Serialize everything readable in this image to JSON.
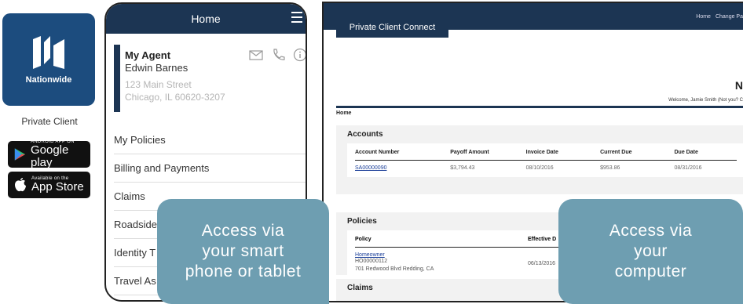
{
  "brand": {
    "name": "Nationwide",
    "caption": "Private Client",
    "color": "#1c4c7e"
  },
  "badges": {
    "google": {
      "small": "ANDROID APP ON",
      "big": "Google play",
      "icon": "play-triangle-icon"
    },
    "apple": {
      "small": "Available on the",
      "big": "App Store",
      "icon": "apple-icon"
    }
  },
  "phone": {
    "title": "Home",
    "agent": {
      "label": "My Agent",
      "name": "Edwin Barnes",
      "address1": "123 Main Street",
      "address2": "Chicago, IL  60620-3207"
    },
    "menu": [
      "My Policies",
      "Billing and Payments",
      "Claims",
      "Roadside",
      "Identity T",
      "Travel As"
    ]
  },
  "desktop": {
    "tab": "Private Client Connect",
    "top_links": [
      "Home",
      "Change Pa"
    ],
    "brand_letter": "N",
    "welcome": "Welcome, Jamie Smith (Not you? C",
    "breadcrumb": "Home",
    "accounts": {
      "title": "Accounts",
      "headers": [
        "Account Number",
        "Payoff Amount",
        "Invoice Date",
        "Current Due",
        "Due Date"
      ],
      "row": [
        "SA00000090",
        "$3,794.43",
        "08/10/2016",
        "$953.86",
        "08/31/2016"
      ]
    },
    "policies": {
      "title": "Policies",
      "headers": [
        "Policy",
        "Effective D"
      ],
      "row": {
        "name": "Homeowner",
        "number": "HO00000112",
        "address": "701 Redwood Blvd Redding, CA",
        "date": "06/13/2016"
      }
    },
    "claims": {
      "title": "Claims"
    }
  },
  "callouts": {
    "left": [
      "Access via",
      "your smart",
      "phone or tablet"
    ],
    "right": [
      "Access via",
      "your",
      "computer"
    ]
  }
}
